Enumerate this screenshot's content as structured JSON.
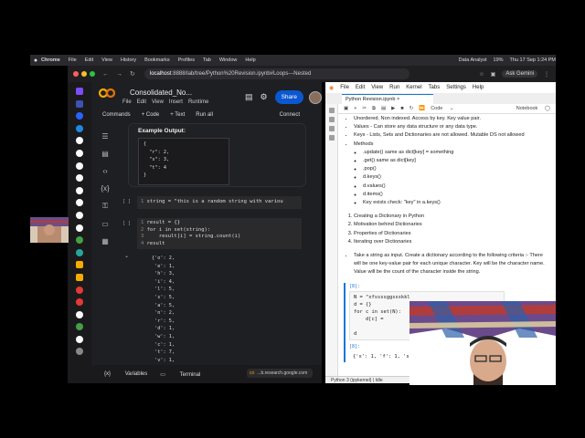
{
  "menubar": {
    "items": [
      "Chrome",
      "File",
      "Edit",
      "View",
      "History",
      "Bookmarks",
      "Profiles",
      "Tab",
      "Window",
      "Help"
    ],
    "status": [
      "Data Analyst",
      "19%",
      "Thu 17 Sep 1:24 PM"
    ]
  },
  "browser": {
    "url_domain": "localhost",
    "url_path": ":8888/lab/tree/Python%20Revision.ipynb#Loops---Nested",
    "ask_label": "Ask Gemini"
  },
  "colab": {
    "title": "Consolidated_No...",
    "menu": [
      "File",
      "Edit",
      "View",
      "Insert",
      "Runtime"
    ],
    "share_label": "Share",
    "toolbar": {
      "commands": "Commands",
      "code": "+ Code",
      "text": "+ Text",
      "run_all": "Run all",
      "connect": "Connect"
    },
    "example_heading": "Example Output:",
    "example_output": "{\n  \"r\": 2,\n  \"s\": 3,\n  \"t\": 4\n}",
    "cell1_bracket": "[ ]",
    "cell1_line": "1",
    "cell1_code": "string = \"this is a random string with variou",
    "cell2_bracket": "[ ]",
    "cell2_lines": [
      "1",
      "2",
      "3",
      "4"
    ],
    "cell2_code": [
      "result = {}",
      "for i in set(string):",
      "    result[i] = string.count(i)",
      "result"
    ],
    "output_lines": "{'o': 2,\n 'e': 1,\n 'h': 3,\n 'i': 4,\n 'l': 5,\n 's': 5,\n 'a': 5,\n 'n': 2,\n 'r': 5,\n 'd': 1,\n 'w': 1,\n 'c': 1,\n 't': 7,\n 'v': 1,\n 'm': 1,\n 'c': 2,\n 'g': 1}",
    "footer": {
      "variables": "Variables",
      "terminal": "Terminal"
    },
    "toast": "...b.research.google.com"
  },
  "jupyter": {
    "menu": [
      "File",
      "Edit",
      "View",
      "Run",
      "Kernel",
      "Tabs",
      "Settings",
      "Help"
    ],
    "tab_title": "Python Revision.ipynb",
    "cell_type": "Code",
    "notebook_label": "Notebook",
    "bullets_top": [
      "Unordered. Non indexed. Access by key. Key value pair.",
      "Values - Can store any data structure or any data type.",
      "Keys - Lists, Sets and Dictionaries are not allowed. Mutable DS not allowed"
    ],
    "methods_label": "Methods",
    "methods": [
      ".update() same as dict[key] = something",
      ".get() same as dict[key]",
      ".pop()",
      "d.keys()",
      "d.values()",
      "d.items()",
      "Key exists check: \"key\" in a.keys()"
    ],
    "numbered": [
      "Creating a Dictionary in Python",
      "Motivation behind Dictionaries",
      "Properties of Dictionaries",
      "Iterating over Dictionaries"
    ],
    "task": "Take a string as input. Create a dictionary according to the following criteria :- There will be one key-value pair for each unique character. Key will be the character name. Value will be the count of the character inside the string.",
    "prompt1": "[8]:",
    "code1": "N = \"xfssssggssskkl\nd = {}\nfor c in set(N):\n    d[c] =\n\nd",
    "prompt2": "[8]:",
    "out2": "{'x': 1, 'f': 1, 's':",
    "status": "Python 3 (ipykernel) | Idle"
  }
}
